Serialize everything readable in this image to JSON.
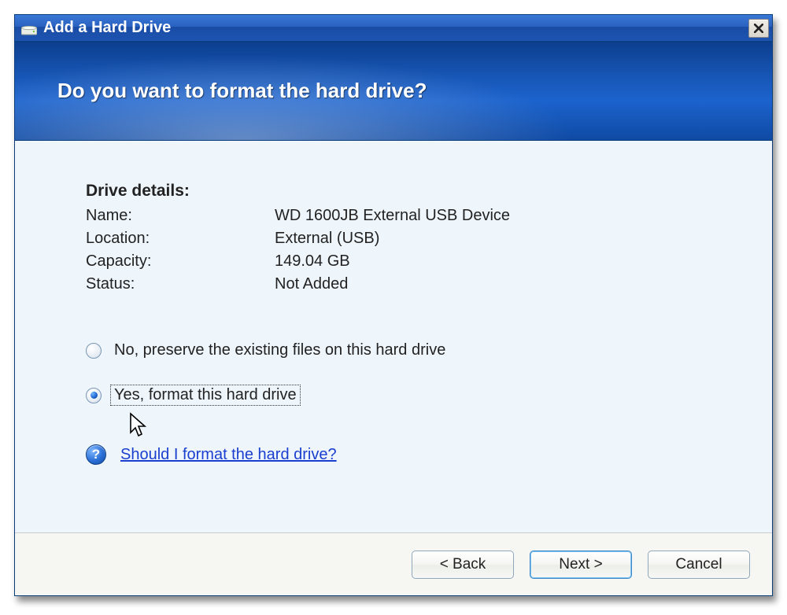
{
  "window": {
    "title": "Add a Hard Drive"
  },
  "banner": {
    "heading": "Do you want to format the hard drive?"
  },
  "details": {
    "heading": "Drive details:",
    "rows": {
      "name_label": "Name:",
      "name_value": "WD 1600JB External USB Device",
      "location_label": "Location:",
      "location_value": "External (USB)",
      "capacity_label": "Capacity:",
      "capacity_value": "149.04 GB",
      "status_label": "Status:",
      "status_value": "Not Added"
    }
  },
  "options": {
    "preserve": "No, preserve the existing files on this hard drive",
    "format": "Yes, format this hard drive"
  },
  "help": {
    "link": "Should I format the hard drive?"
  },
  "buttons": {
    "back": "< Back",
    "next": "Next >",
    "cancel": "Cancel"
  }
}
